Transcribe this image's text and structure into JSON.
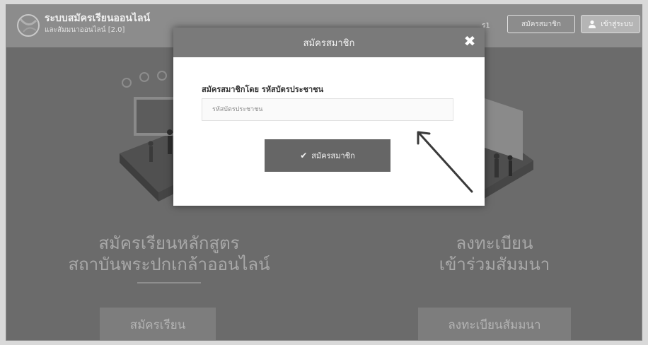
{
  "header": {
    "site_title": "ระบบสมัครเรียนออนไลน์",
    "site_subtitle": "และสัมมนาออนไลน์ [2.0]",
    "extra_text": "ร1",
    "register_label": "สมัครสมาชิก",
    "login_label": "เข้าสู่ระบบ"
  },
  "hero": {
    "left_line1": "สมัครเรียนหลักสูตร",
    "left_line2": "สถาบันพระปกเกล้าออนไลน์",
    "right_line1": "ลงทะเบียน",
    "right_line2": "เข้าร่วมสัมมนา",
    "cta_left": "สมัครเรียน",
    "cta_right": "ลงทะเบียนสัมมนา"
  },
  "modal": {
    "title": "สมัครสมาชิก",
    "close_glyph": "✖",
    "field_label": "สมัครสมาชิกโดย รหัสบัตรประชาชน",
    "input_placeholder": "รหัสบัตรประชาชน",
    "input_value": "",
    "submit_label": "สมัครสมาชิก",
    "submit_icon": "✔"
  },
  "colors": {
    "overlay": "#6b6b6b",
    "modal_header": "#7a7a7a",
    "submit_button": "#666666"
  },
  "icons": [
    "logo-icon",
    "user-icon",
    "close-icon",
    "check-icon",
    "arrow-annotation-icon"
  ]
}
